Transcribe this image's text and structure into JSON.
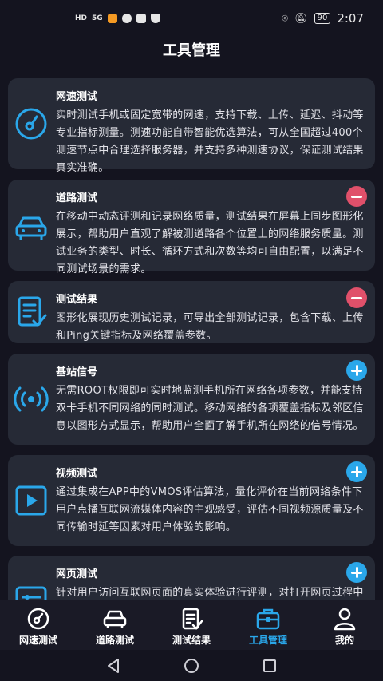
{
  "status_bar": {
    "left_label": "HD",
    "signal_label": "5G",
    "battery": "90",
    "time": "2:07"
  },
  "page_title": "工具管理",
  "tools": [
    {
      "title": "网速测试",
      "description": "实时测试手机或固定宽带的网速，支持下载、上传、延迟、抖动等专业指标测量。测速功能自带智能优选算法，可从全国超过400个测速节点中合理选择服务器，并支持多种测速协议，保证测试结果真实准确。",
      "icon": "speedometer-icon",
      "action": "none"
    },
    {
      "title": "道路测试",
      "description": "在移动中动态评测和记录网络质量，测试结果在屏幕上同步图形化展示，帮助用户直观了解被测道路各个位置上的网络服务质量。测试业务的类型、时长、循环方式和次数等均可自由配置，以满足不同测试场景的需求。",
      "icon": "car-icon",
      "action": "remove"
    },
    {
      "title": "测试结果",
      "description": "图形化展现历史测试记录，可导出全部测试记录，包含下载、上传和Ping关键指标及网络覆盖参数。",
      "icon": "report-icon",
      "action": "remove"
    },
    {
      "title": "基站信号",
      "description": "无需ROOT权限即可实时地监测手机所在网络各项参数，并能支持双卡手机不同网络的同时测试。移动网络的各项覆盖指标及邻区信息以图形方式显示，帮助用户全面了解手机所在网络的信号情况。",
      "icon": "signal-icon",
      "action": "add"
    },
    {
      "title": "视频测试",
      "description": "通过集成在APP中的VMOS评估算法，量化评价在当前网络条件下用户点播互联网流媒体内容的主观感受，评估不同视频源质量及不同传输时延等因素对用户体验的影响。",
      "icon": "video-play-icon",
      "action": "add"
    },
    {
      "title": "网页测试",
      "description": "针对用户访问互联网页面的真实体验进行评测，对打开网页过程中各项指标，如域名解析时间、连接时延、加",
      "icon": "web-sliders-icon",
      "action": "add"
    }
  ],
  "tabs": [
    {
      "label": "网速测试",
      "icon": "speedometer-icon",
      "active": false
    },
    {
      "label": "道路测试",
      "icon": "car-icon",
      "active": false
    },
    {
      "label": "测试结果",
      "icon": "report-icon",
      "active": false
    },
    {
      "label": "工具管理",
      "icon": "toolbox-icon",
      "active": true
    },
    {
      "label": "我的",
      "icon": "user-icon",
      "active": false
    }
  ],
  "colors": {
    "background": "#14141f",
    "card": "#262a36",
    "accent": "#2aa7ea",
    "remove": "#e0506a"
  }
}
